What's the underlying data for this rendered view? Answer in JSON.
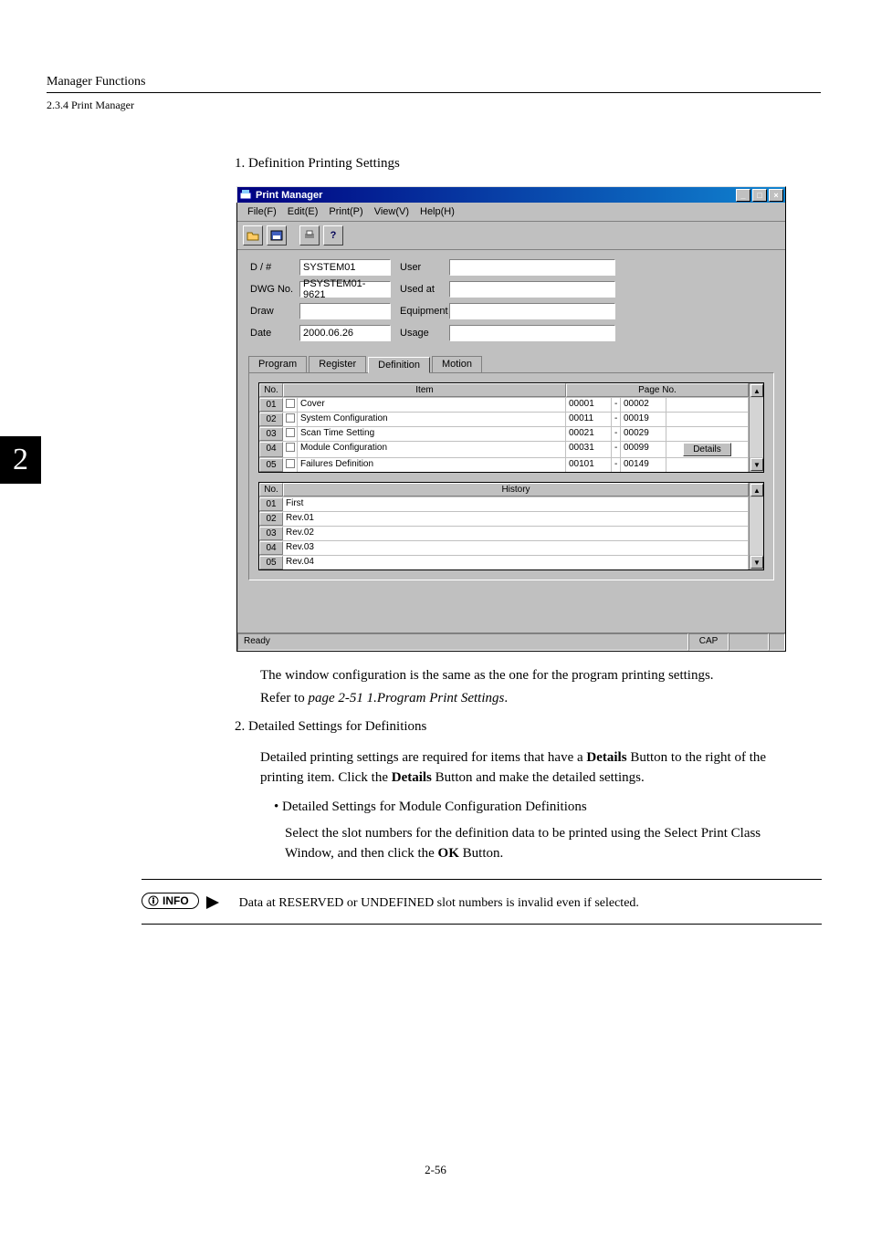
{
  "doc": {
    "header": "Manager Functions",
    "subhead": "2.3.4  Print Manager",
    "tab_number": "2",
    "page_number": "2-56"
  },
  "steps": {
    "s1": "1.  Definition Printing Settings",
    "para1": "The window configuration is the same as the one for the program printing settings.",
    "para2a": "Refer to ",
    "para2b": "page 2-51 1.Program Print Settings",
    "para2c": ".",
    "s2": "2.  Detailed Settings for Definitions",
    "para3": "Detailed printing settings are required for items that have a Details Button to the right of the printing item. Click the Details Button and make the detailed settings.",
    "bullet": "•  Detailed Settings for Module Configuration Definitions",
    "para4": "Select the slot numbers for the definition data to be printed using the Select Print Class Window, and then click the OK Button."
  },
  "info": {
    "label": "INFO",
    "text": "Data at RESERVED or UNDEFINED slot numbers is invalid even if selected."
  },
  "pm": {
    "title": "Print Manager",
    "menu": {
      "file": "File(F)",
      "edit": "Edit(E)",
      "print": "Print(P)",
      "view": "View(V)",
      "help": "Help(H)"
    },
    "form": {
      "labels": {
        "dh": "D / #",
        "dwg": "DWG No.",
        "draw": "Draw",
        "date": "Date",
        "user": "User",
        "usedat": "Used at",
        "equipment": "Equipment",
        "usage": "Usage"
      },
      "values": {
        "dh": "SYSTEM01",
        "dwg": "PSYSTEM01-9621",
        "draw": "",
        "date": "2000.06.26",
        "user": "",
        "usedat": "",
        "equipment": "",
        "usage": ""
      }
    },
    "tabs": {
      "program": "Program",
      "register": "Register",
      "definition": "Definition",
      "motion": "Motion"
    },
    "grid1": {
      "headers": {
        "no": "No.",
        "item": "Item",
        "page": "Page No."
      },
      "details_label": "Details",
      "rows": [
        {
          "no": "01",
          "item": "Cover",
          "p1": "00001",
          "p2": "00002"
        },
        {
          "no": "02",
          "item": "System Configuration",
          "p1": "00011",
          "p2": "00019"
        },
        {
          "no": "03",
          "item": "Scan Time Setting",
          "p1": "00021",
          "p2": "00029"
        },
        {
          "no": "04",
          "item": "Module Configuration",
          "p1": "00031",
          "p2": "00099",
          "details": true
        },
        {
          "no": "05",
          "item": "Failures Definition",
          "p1": "00101",
          "p2": "00149"
        }
      ]
    },
    "grid2": {
      "headers": {
        "no": "No.",
        "history": "History"
      },
      "rows": [
        {
          "no": "01",
          "h": "First"
        },
        {
          "no": "02",
          "h": "Rev.01"
        },
        {
          "no": "03",
          "h": "Rev.02"
        },
        {
          "no": "04",
          "h": "Rev.03"
        },
        {
          "no": "05",
          "h": "Rev.04"
        }
      ]
    },
    "status": {
      "ready": "Ready",
      "cap": "CAP"
    }
  }
}
